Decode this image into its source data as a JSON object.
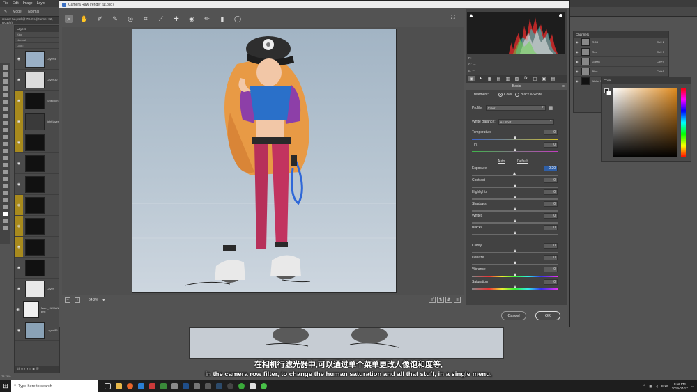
{
  "ps": {
    "menu": [
      "File",
      "Edit",
      "Image",
      "Layer"
    ],
    "options": [
      "Mode:",
      "Normal"
    ],
    "doc_tab": "render tut.psd @ 78.8% (Runner 02, RGB/8)",
    "layers_panel": {
      "title": "Layers",
      "kind_label": "Kind",
      "blend_mode": "Normal",
      "lock_label": "Lock:",
      "layers": [
        {
          "name": "Layer 4",
          "gold": false
        },
        {
          "name": "Layer 32",
          "gold": false
        },
        {
          "name": "Selection",
          "gold": true
        },
        {
          "name": "light layer",
          "gold": true
        },
        {
          "name": "",
          "gold": true
        },
        {
          "name": "",
          "gold": false
        },
        {
          "name": "",
          "gold": false
        },
        {
          "name": "",
          "gold": true
        },
        {
          "name": "",
          "gold": true
        },
        {
          "name": "",
          "gold": true
        },
        {
          "name": "",
          "gold": false
        },
        {
          "name": "Layer",
          "gold": false
        },
        {
          "name": "Main_HUMAN BRI",
          "gold": false
        },
        {
          "name": "Layer 85",
          "gold": false
        }
      ]
    },
    "channels_panel": {
      "title": "Channels",
      "rows": [
        {
          "name": "RGB",
          "shortcut": "Ctrl+2"
        },
        {
          "name": "Red",
          "shortcut": "Ctrl+3"
        },
        {
          "name": "Green",
          "shortcut": "Ctrl+4"
        },
        {
          "name": "Blue",
          "shortcut": "Ctrl+5"
        },
        {
          "name": "Alpha 1",
          "shortcut": "Ctrl+6"
        }
      ]
    },
    "color_panel": {
      "title": "Color"
    },
    "zoom_status": "78.78%"
  },
  "camera_raw": {
    "title": "Camera Raw (render tut.psd)",
    "zoom": "64.2%",
    "readout": {
      "r": "R:  ---",
      "g": "G:  ---",
      "b": "B:  ---"
    },
    "panel_title": "Basic",
    "treatment_label": "Treatment:",
    "treatment_color": "Color",
    "treatment_bw": "Black & White",
    "profile_label": "Profile:",
    "profile_value": "Color",
    "wb_label": "White Balance:",
    "wb_value": "As Shot",
    "auto_label": "Auto",
    "default_label": "Default",
    "sliders": [
      {
        "label": "Temperature",
        "value": "0",
        "pos": 0.5,
        "track": "temp"
      },
      {
        "label": "Tint",
        "value": "0",
        "pos": 0.5,
        "track": "tint"
      },
      {
        "label": "Exposure",
        "value": "-0.20",
        "pos": 0.49,
        "track": "",
        "active": true
      },
      {
        "label": "Contrast",
        "value": "0",
        "pos": 0.5,
        "track": ""
      },
      {
        "label": "Highlights",
        "value": "0",
        "pos": 0.5,
        "track": ""
      },
      {
        "label": "Shadows",
        "value": "0",
        "pos": 0.5,
        "track": ""
      },
      {
        "label": "Whites",
        "value": "0",
        "pos": 0.5,
        "track": ""
      },
      {
        "label": "Blacks",
        "value": "0",
        "pos": 0.5,
        "track": ""
      },
      {
        "label": "Clarity",
        "value": "0",
        "pos": 0.5,
        "track": ""
      },
      {
        "label": "Dehaze",
        "value": "0",
        "pos": 0.5,
        "track": ""
      },
      {
        "label": "Vibrance",
        "value": "0",
        "pos": 0.5,
        "track": "vib"
      },
      {
        "label": "Saturation",
        "value": "0",
        "pos": 0.5,
        "track": "sat"
      }
    ],
    "cancel_label": "Cancel",
    "ok_label": "OK",
    "view_y_label": "Y"
  },
  "subtitles": {
    "zh": "在相机行滤光器中,可以通过单个菜单更改人像饱和度等,",
    "en": "in the camera row filter, to change the human saturation and all that stuff, in a single menu,"
  },
  "taskbar": {
    "search_placeholder": "Type here to search",
    "lang": "ENG",
    "time": "8:12 PM",
    "date": "2019-07-17"
  },
  "colors": {
    "accent_blue": "#2f5fa7",
    "layer_gold": "#a88a1d",
    "dialog_bg": "#535353",
    "panel_bg": "#424242"
  }
}
